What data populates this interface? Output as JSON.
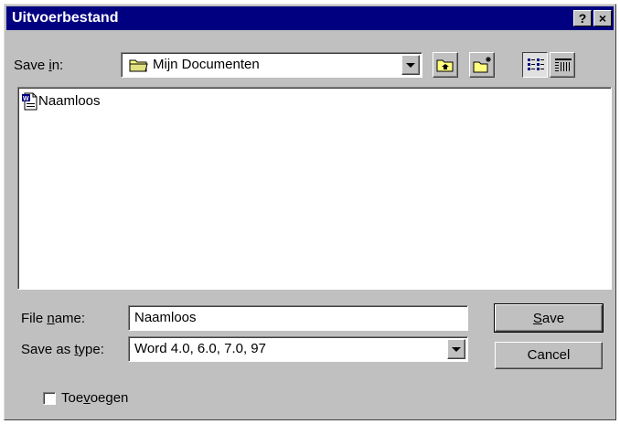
{
  "window": {
    "title": "Uitvoerbestand",
    "help_glyph": "?",
    "close_glyph": "×"
  },
  "save_in": {
    "label_pre": "Save ",
    "label_key": "i",
    "label_post": "n:",
    "value": "Mijn Documenten",
    "icon": "folder-icon"
  },
  "toolbar": {
    "up_folder_icon": "up-one-level-icon",
    "new_folder_icon": "new-folder-icon",
    "list_view_icon": "list-view-icon",
    "details_view_icon": "details-view-icon"
  },
  "file_list": {
    "items": [
      {
        "name": "Naamloos",
        "icon": "word-document-icon"
      }
    ]
  },
  "file_name": {
    "label_pre": "File ",
    "label_key": "n",
    "label_post": "ame:",
    "value": "Naamloos"
  },
  "save_as_type": {
    "label_pre": "Save as ",
    "label_key": "t",
    "label_post": "ype:",
    "value": "Word 4.0, 6.0, 7.0, 97"
  },
  "buttons": {
    "save_key": "S",
    "save_rest": "ave",
    "cancel": "Cancel"
  },
  "append": {
    "label_pre": "Toe",
    "label_key": "v",
    "label_post": "oegen",
    "checked": false
  }
}
